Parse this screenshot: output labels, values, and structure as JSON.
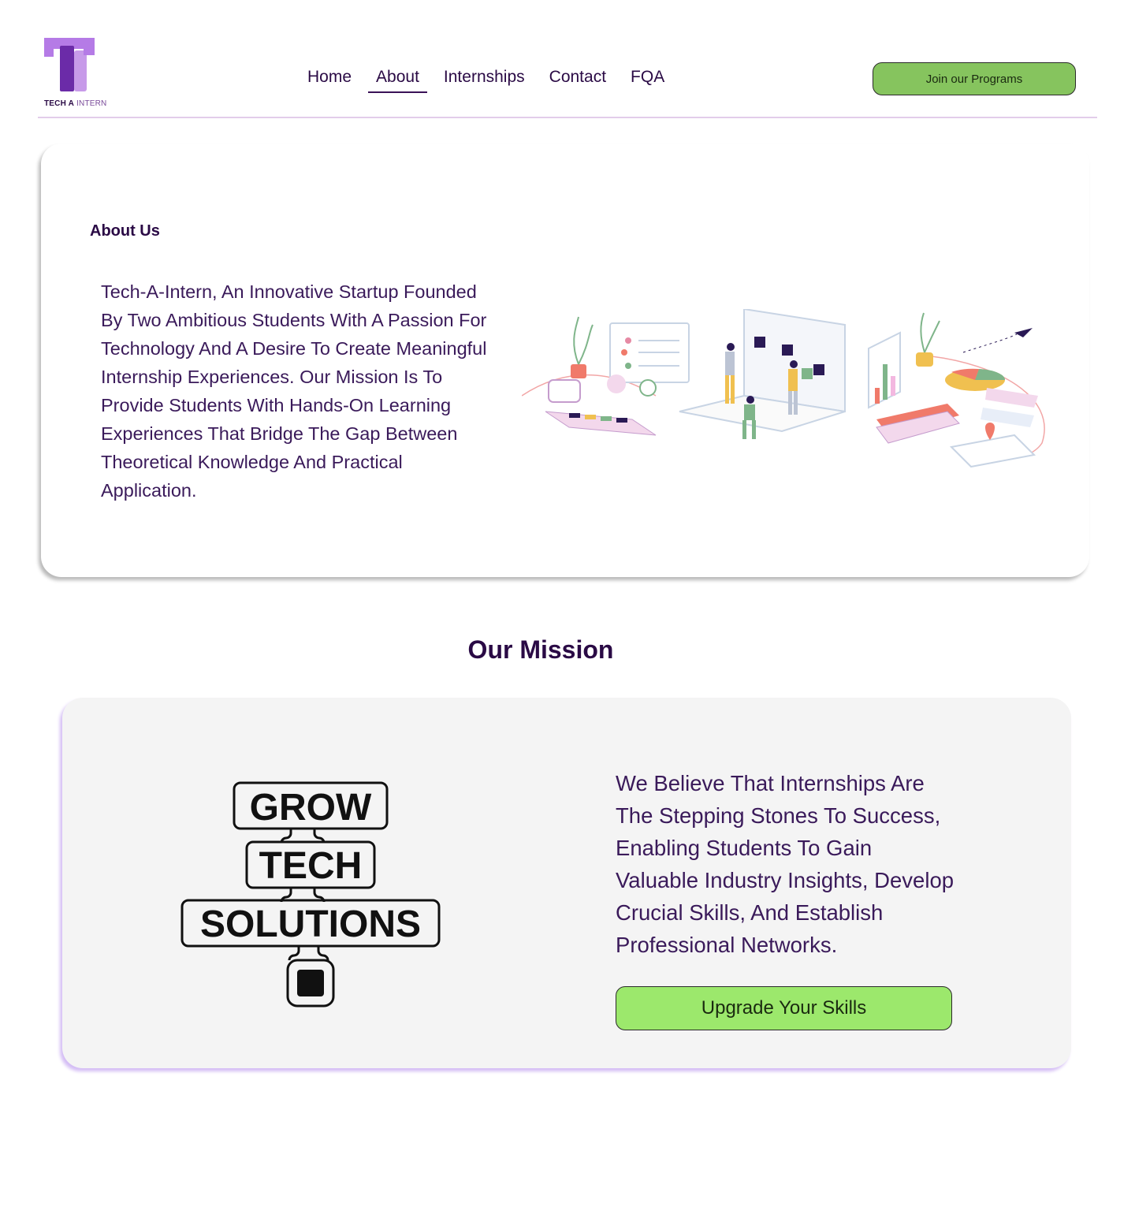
{
  "brand": {
    "logo_bold": "TECH A",
    "logo_light": "INTERN"
  },
  "nav": {
    "items": [
      "Home",
      "About",
      "Internships",
      "Contact",
      "FQA"
    ],
    "active": "About"
  },
  "header": {
    "cta_label": "Join our Programs"
  },
  "about": {
    "title": "About Us",
    "body": "Tech-A-Intern, An Innovative Startup Founded By Two Ambitious Students With A Passion For Technology And A Desire To Create Meaningful Internship Experiences. Our Mission Is To Provide Students With Hands-On Learning Experiences That Bridge The Gap Between Theoretical Knowledge And Practical Application."
  },
  "mission": {
    "title": "Our Mission",
    "logo_words": [
      "GROW",
      "TECH",
      "SOLUTIONS"
    ],
    "body": "We Believe That Internships Are The Stepping Stones To Success, Enabling Students To Gain Valuable Industry Insights, Develop Crucial Skills, And Establish Professional Networks.",
    "cta_label": "Upgrade Your Skills"
  },
  "colors": {
    "brand_purple": "#7b2fbf",
    "accent_green": "#86c45e",
    "button_green_light": "#9ce86c",
    "text_dark": "#2a0a45"
  }
}
